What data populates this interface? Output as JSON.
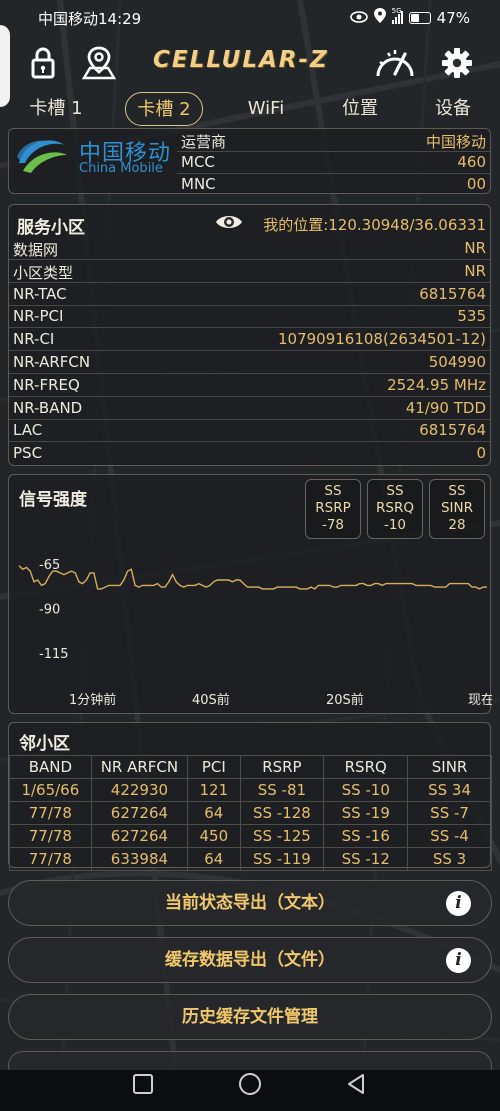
{
  "status_bar": {
    "carrier_time": "中国移动14:29",
    "network_badge": "5G",
    "battery": "47%",
    "battery_level": 0.47
  },
  "header": {
    "app_name": "CELLULAR-Z",
    "icons": [
      "lock-icon",
      "location-pin-icon",
      "gauge-icon",
      "gear-icon"
    ]
  },
  "tabs": [
    {
      "label": "卡槽 1",
      "active": false
    },
    {
      "label": "卡槽 2",
      "active": true
    },
    {
      "label": "WiFi",
      "active": false
    },
    {
      "label": "位置",
      "active": false
    },
    {
      "label": "设备",
      "active": false
    }
  ],
  "carrier": {
    "logo_cn": "中国移动",
    "logo_en": "China Mobile",
    "rows": [
      {
        "key": "运营商",
        "value": "中国移动"
      },
      {
        "key": "MCC",
        "value": "460"
      },
      {
        "key": "MNC",
        "value": "00"
      }
    ]
  },
  "serving_cell": {
    "title": "服务小区",
    "my_location": "我的位置:120.30948/36.06331",
    "rows": [
      {
        "key": "数据网",
        "value": "NR"
      },
      {
        "key": "小区类型",
        "value": "NR"
      },
      {
        "key": "NR-TAC",
        "value": "6815764"
      },
      {
        "key": "NR-PCI",
        "value": "535"
      },
      {
        "key": "NR-CI",
        "value": "10790916108(2634501-12)"
      },
      {
        "key": "NR-ARFCN",
        "value": "504990"
      },
      {
        "key": "NR-FREQ",
        "value": "2524.95 MHz"
      },
      {
        "key": "NR-BAND",
        "value": "41/90 TDD"
      },
      {
        "key": "LAC",
        "value": "6815764"
      },
      {
        "key": "PSC",
        "value": "0"
      }
    ]
  },
  "signal": {
    "title": "信号强度",
    "metrics": [
      {
        "l1": "SS",
        "l2": "RSRP",
        "v": "-78"
      },
      {
        "l1": "SS",
        "l2": "RSRQ",
        "v": "-10"
      },
      {
        "l1": "SS",
        "l2": "SINR",
        "v": "28"
      }
    ],
    "y_ticks": [
      "-65",
      "-90",
      "-115"
    ],
    "x_ticks": [
      "1分钟前",
      "40S前",
      "20S前",
      "现在"
    ],
    "line_color": "#d9ad5c"
  },
  "chart_data": {
    "type": "line",
    "series": [
      {
        "values": [
          -66,
          -68,
          -67,
          -69,
          -75,
          -74,
          -77,
          -76,
          -72,
          -69,
          -69,
          -70,
          -71,
          -70,
          -69,
          -70,
          -75,
          -76,
          -74,
          -70,
          -70,
          -79,
          -79,
          -78,
          -77,
          -77,
          -77,
          -77,
          -74,
          -69,
          -68,
          -77,
          -78,
          -77,
          -77,
          -77,
          -77,
          -76,
          -78,
          -78,
          -75,
          -71,
          -75,
          -77,
          -78,
          -77,
          -77,
          -77,
          -76,
          -77,
          -78,
          -77,
          -75,
          -74,
          -74,
          -74,
          -74,
          -75,
          -74,
          -74,
          -76,
          -78,
          -78,
          -78,
          -78,
          -79,
          -79,
          -79,
          -79,
          -78,
          -78,
          -78,
          -78,
          -78,
          -78,
          -79,
          -79,
          -79,
          -78,
          -79,
          -77,
          -77,
          -77,
          -77,
          -78,
          -78,
          -77,
          -77,
          -77,
          -77,
          -77,
          -76,
          -76,
          -77,
          -77,
          -76,
          -76,
          -77,
          -76,
          -76,
          -76,
          -76,
          -76,
          -76,
          -76,
          -76,
          -77,
          -77,
          -77,
          -77,
          -77,
          -78,
          -78,
          -78,
          -78,
          -76,
          -76,
          -76,
          -76,
          -76,
          -76,
          -78,
          -78,
          -79,
          -78,
          -78
        ]
      }
    ],
    "y_range": [
      -130,
      -60
    ],
    "x_ticks": [
      "1分钟前",
      "40S前",
      "20S前",
      "现在"
    ]
  },
  "neighbors": {
    "title": "邻小区",
    "headers": [
      "BAND",
      "NR ARFCN",
      "PCI",
      "RSRP",
      "RSRQ",
      "SINR"
    ],
    "rows": [
      [
        "1/65/66",
        "422930",
        "121",
        "SS -81",
        "SS -10",
        "SS 34"
      ],
      [
        "77/78",
        "627264",
        "64",
        "SS -128",
        "SS -19",
        "SS -7"
      ],
      [
        "77/78",
        "627264",
        "450",
        "SS -125",
        "SS -16",
        "SS -4"
      ],
      [
        "77/78",
        "633984",
        "64",
        "SS -119",
        "SS -12",
        "SS 3"
      ]
    ]
  },
  "actions": {
    "export_text": "当前状态导出（文本）",
    "export_file": "缓存数据导出（文件）",
    "history": "历史缓存文件管理"
  }
}
